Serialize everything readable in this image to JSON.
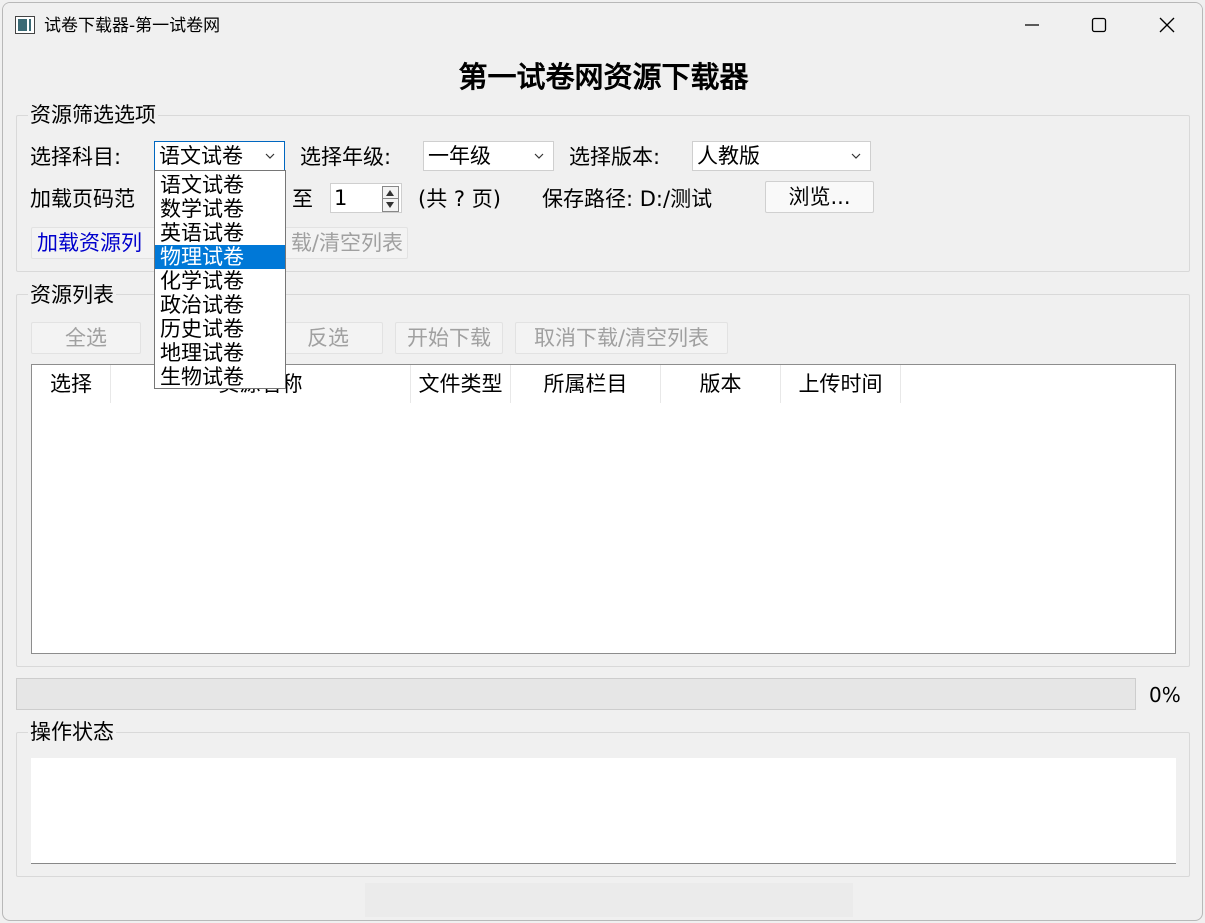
{
  "window": {
    "title": "试卷下载器-第一试卷网"
  },
  "main_title": "第一试卷网资源下载器",
  "filter_group": {
    "title": "资源筛选选项",
    "subject_label": "选择科目:",
    "subject_value": "语文试卷",
    "grade_label": "选择年级:",
    "grade_value": "一年级",
    "edition_label": "选择版本:",
    "edition_value": "人教版",
    "page_range_label": "加载页码范",
    "to_label": "至",
    "to_value": "1",
    "total_pages": "(共 ? 页)",
    "save_path_label": "保存路径: D:/测试",
    "browse_button": "浏览...",
    "load_button": "加载资源列",
    "cancel_clear_button": "载/清空列表"
  },
  "subject_dropdown": {
    "items": [
      "语文试卷",
      "数学试卷",
      "英语试卷",
      "物理试卷",
      "化学试卷",
      "政治试卷",
      "历史试卷",
      "地理试卷",
      "生物试卷"
    ],
    "highlighted_index": 3
  },
  "resource_group": {
    "title": "资源列表",
    "select_all": "全选",
    "invert": "反选",
    "start_download": "开始下载",
    "cancel_clear": "取消下载/清空列表",
    "columns": [
      "选择",
      "资源名称",
      "文件类型",
      "所属栏目",
      "版本",
      "上传时间"
    ]
  },
  "progress": {
    "value_percent": 0,
    "label": "0%"
  },
  "status_group": {
    "title": "操作状态"
  }
}
